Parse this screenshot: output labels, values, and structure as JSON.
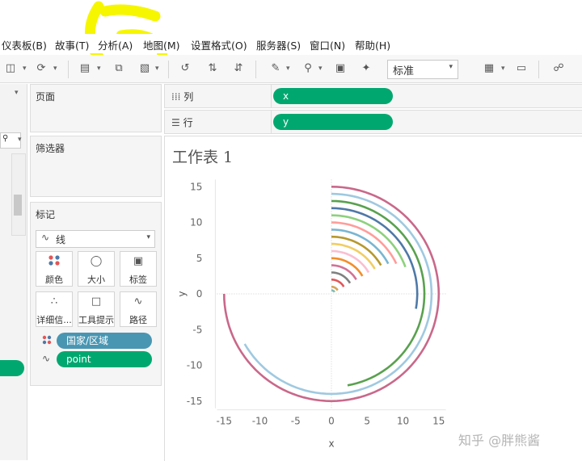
{
  "menubar": {
    "items": [
      "仪表板(B)",
      "故事(T)",
      "分析(A)",
      "地图(M)",
      "设置格式(O)",
      "服务器(S)",
      "窗口(N)",
      "帮助(H)"
    ]
  },
  "toolbar": {
    "fit_select": "标准",
    "icons": [
      "save-icon",
      "undo-icon",
      "new-worksheet-icon",
      "duplicate-sheet-icon",
      "clear-sheet-icon",
      "swap-icon",
      "sort-asc-icon",
      "sort-desc-icon",
      "highlight-icon",
      "pin-icon",
      "label-icon",
      "pushpin-icon",
      "show-me-icon",
      "presentation-icon",
      "share-icon"
    ]
  },
  "cards": {
    "pages": "页面",
    "filters": "筛选器",
    "marks": "标记",
    "mark_type": "线",
    "buttons": [
      "颜色",
      "大小",
      "标签",
      "详细信...",
      "工具提示",
      "路径"
    ],
    "color_field": "国家/区域",
    "path_field": "point"
  },
  "shelves": {
    "columns_label": "列",
    "columns_field": "x",
    "rows_label": "行",
    "rows_field": "y"
  },
  "sheet": {
    "title": "工作表 1"
  },
  "watermark": "知乎 @胖熊酱",
  "colors": {
    "pill_green": "#00a870",
    "pill_blue": "#4996b2",
    "highlight": "#f6f600"
  },
  "chart_data": {
    "type": "line",
    "xlabel": "x",
    "ylabel": "y",
    "xlim": [
      -16,
      16
    ],
    "ylim": [
      -16,
      16
    ],
    "x_ticks": [
      -15,
      -10,
      -5,
      0,
      5,
      10,
      15
    ],
    "y_ticks": [
      15,
      10,
      5,
      0,
      -5,
      -10,
      -15
    ],
    "series_note": "concentric arcs starting at 12 o'clock, clockwise",
    "series": [
      {
        "radius": 15.0,
        "sweep_deg": 270,
        "color": "#c9688a"
      },
      {
        "radius": 14.0,
        "sweep_deg": 240,
        "color": "#9fc9e0"
      },
      {
        "radius": 13.0,
        "sweep_deg": 170,
        "color": "#59a14f"
      },
      {
        "radius": 12.0,
        "sweep_deg": 100,
        "color": "#4e79a7"
      },
      {
        "radius": 11.0,
        "sweep_deg": 70,
        "color": "#8cd17d"
      },
      {
        "radius": 10.0,
        "sweep_deg": 65,
        "color": "#ff9d9a"
      },
      {
        "radius": 9.0,
        "sweep_deg": 62,
        "color": "#79b6d2"
      },
      {
        "radius": 8.0,
        "sweep_deg": 60,
        "color": "#b6992d"
      },
      {
        "radius": 7.0,
        "sweep_deg": 60,
        "color": "#f1ce63"
      },
      {
        "radius": 6.0,
        "sweep_deg": 60,
        "color": "#fabfd2"
      },
      {
        "radius": 5.0,
        "sweep_deg": 60,
        "color": "#f28e2b"
      },
      {
        "radius": 4.0,
        "sweep_deg": 60,
        "color": "#d37295"
      },
      {
        "radius": 3.0,
        "sweep_deg": 60,
        "color": "#808080"
      },
      {
        "radius": 2.0,
        "sweep_deg": 60,
        "color": "#e15759"
      },
      {
        "radius": 1.0,
        "sweep_deg": 60,
        "color": "#d4a55a"
      },
      {
        "radius": 0.5,
        "sweep_deg": 60,
        "color": "#86bcb6"
      }
    ]
  }
}
